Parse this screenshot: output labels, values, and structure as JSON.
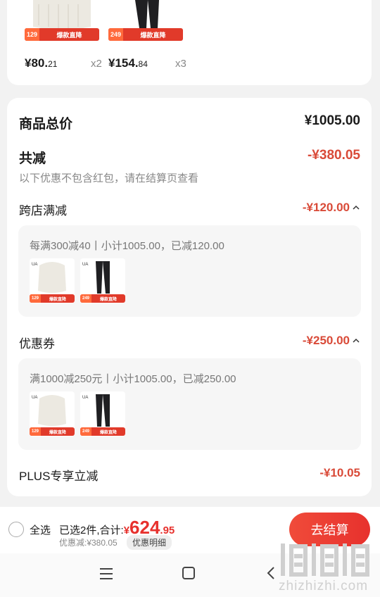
{
  "products_top": [
    {
      "tag_num": "129",
      "tag_text": "爆款直降",
      "price_main": "¥80.",
      "price_cents": "21",
      "qty": "x2"
    },
    {
      "tag_num": "249",
      "tag_text": "爆款直降",
      "price_main": "¥154.",
      "price_cents": "84",
      "qty": "x3"
    }
  ],
  "summary": {
    "total_label": "商品总价",
    "total_value": "¥1005.00",
    "reduce_label": "共减",
    "reduce_value": "-¥380.05",
    "reduce_note": "以下优惠不包含红包，请在结算页查看"
  },
  "cross_store": {
    "label": "跨店满减",
    "value": "-¥120.00",
    "detail": "每满300减40丨小计1005.00，已减120.00",
    "items": [
      {
        "tag_num": "129",
        "tag_text": "爆款直降"
      },
      {
        "tag_num": "249",
        "tag_text": "爆款直降"
      }
    ]
  },
  "coupon": {
    "label": "优惠券",
    "value": "-¥250.00",
    "detail": "满1000减250元丨小计1005.00，已减250.00",
    "items": [
      {
        "tag_num": "129",
        "tag_text": "爆款直降"
      },
      {
        "tag_num": "249",
        "tag_text": "爆款直降"
      }
    ]
  },
  "plus": {
    "label": "PLUS专享立减",
    "value": "-¥10.05"
  },
  "bottom": {
    "select_all": "全选",
    "selected_text": "已选2件,合计:",
    "currency": "¥",
    "total_int": "624",
    "total_dec": ".95",
    "discount_text": "优惠减:¥380.05",
    "discount_detail": "优惠明细",
    "checkout": "去结算"
  },
  "watermark": {
    "domain": "zhizhizhi.com"
  },
  "colors": {
    "accent": "#d94a38",
    "tag_red": "#e13a2a",
    "checkout_red": "#ec3e32"
  }
}
